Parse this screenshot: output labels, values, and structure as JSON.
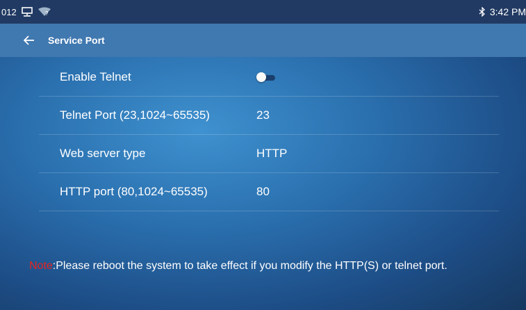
{
  "status_bar": {
    "left_text": "012",
    "wifi_badge": "?",
    "time": "3:42 PM",
    "icons": [
      "display-icon",
      "wifi-icon",
      "bluetooth-icon"
    ]
  },
  "app_bar": {
    "title": "Service Port",
    "back_icon": "arrow-left-icon"
  },
  "settings": [
    {
      "label": "Enable Telnet",
      "type": "toggle",
      "on": false
    },
    {
      "label": "Telnet Port (23,1024~65535)",
      "value": "23"
    },
    {
      "label": "Web server type",
      "value": "HTTP"
    },
    {
      "label": "HTTP port (80,1024~65535)",
      "value": "80"
    }
  ],
  "note": {
    "label": "Note",
    "text": ":Please reboot the system to take effect if you modify the HTTP(S) or telnet port."
  },
  "colors": {
    "status_bar": "#213a63",
    "app_bar": "#4078b0",
    "note_label": "#e5241f"
  }
}
